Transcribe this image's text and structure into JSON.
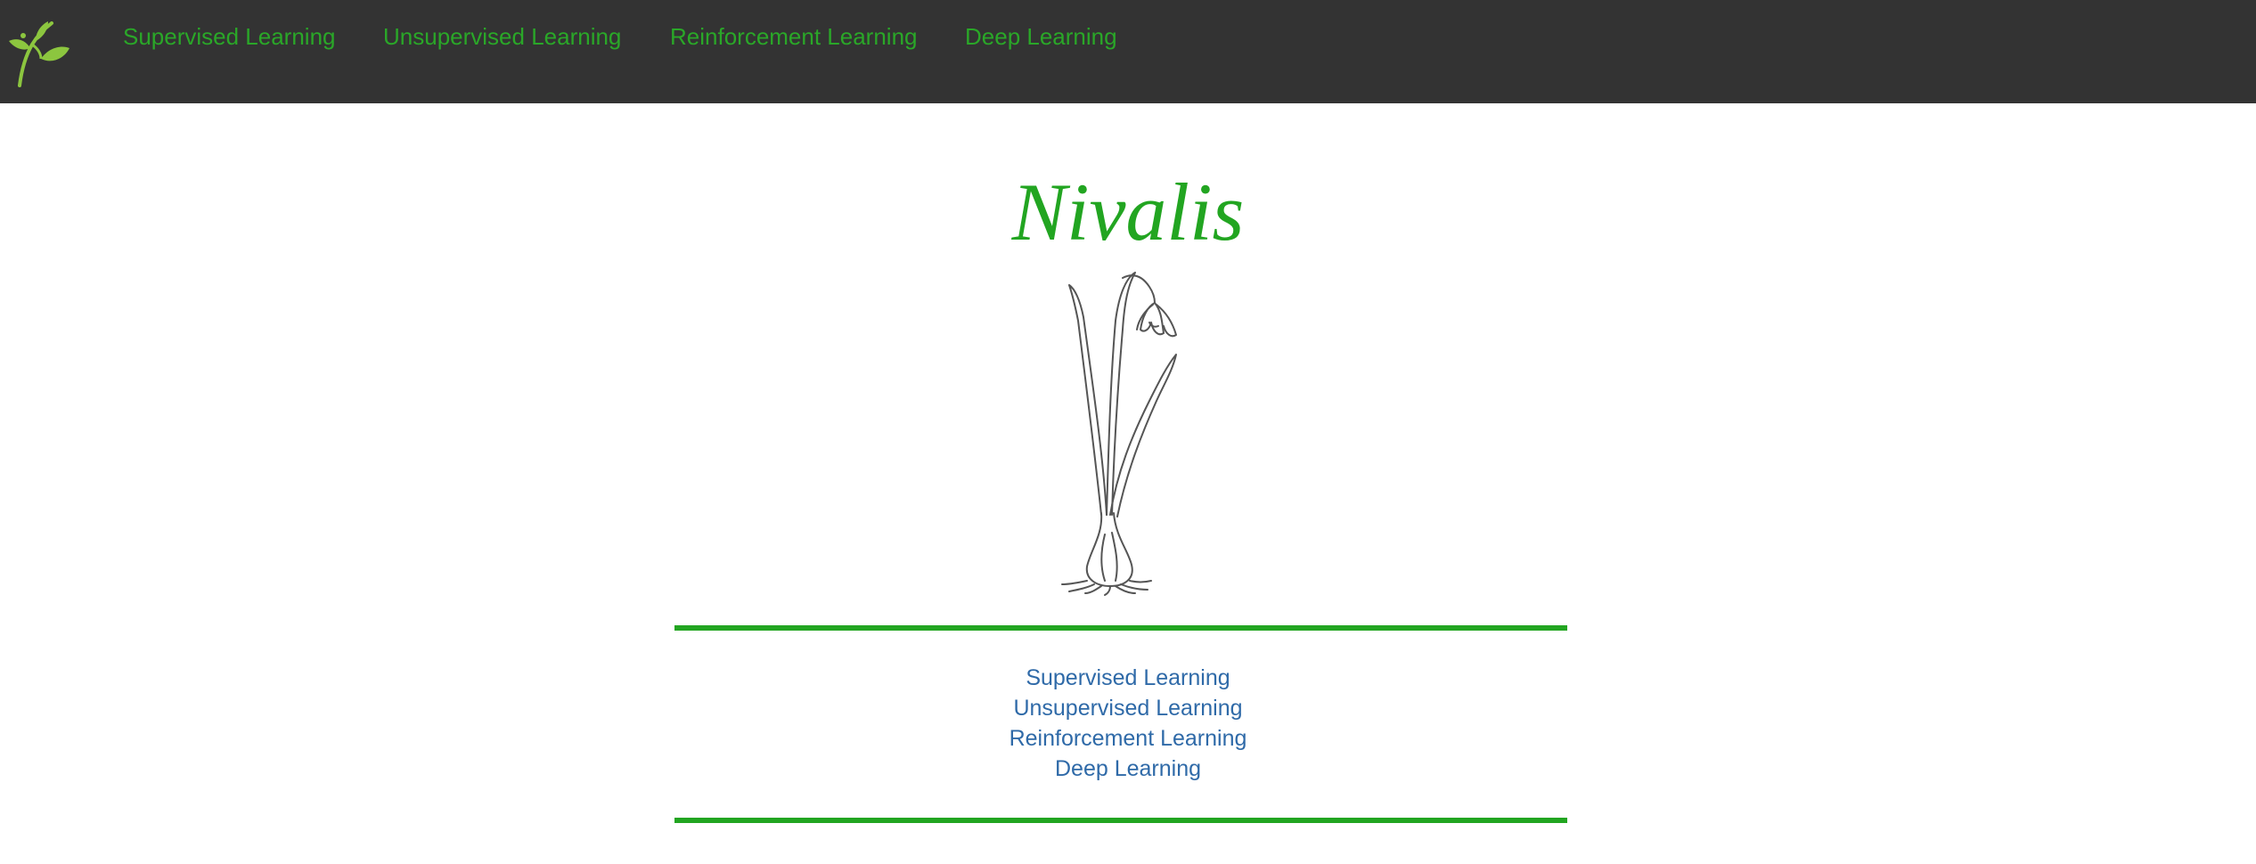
{
  "nav": {
    "logo_icon": "leafy-sprig-icon",
    "links": [
      "Supervised Learning",
      "Unsupervised Learning",
      "Reinforcement Learning",
      "Deep Learning"
    ]
  },
  "main": {
    "title": "Nivalis",
    "image_icon": "snowdrop-flower-illustration",
    "links": [
      "Supervised Learning",
      "Unsupervised Learning",
      "Reinforcement Learning",
      "Deep Learning"
    ]
  },
  "colors": {
    "nav_background": "#333333",
    "nav_link": "#2aa728",
    "title": "#22a521",
    "rule": "#22a521",
    "body_link": "#2f6aa8"
  }
}
